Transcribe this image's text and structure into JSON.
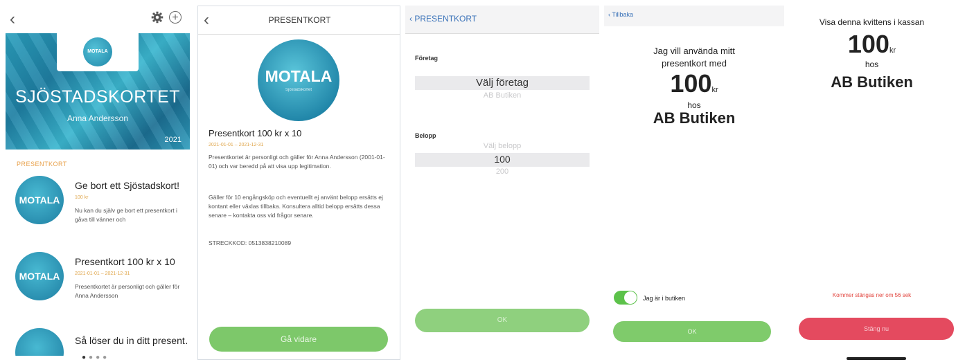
{
  "screen1": {
    "back_icon": "chevron-left-icon",
    "settings_icon": "gear-icon",
    "add_icon": "plus-circle-icon",
    "card": {
      "logo_text": "MOTALA",
      "title": "SJÖSTADSKORTET",
      "holder": "Anna Andersson",
      "year": "2021"
    },
    "section_label": "PRESENTKORT",
    "offers": [
      {
        "logo": "MOTALA",
        "title": "Ge bort ett Sjöstadskort!",
        "sub": "100 kr",
        "text": "Nu kan du själv ge bort ett presentkort i gåva till vänner och"
      },
      {
        "logo": "MOTALA",
        "title": "Presentkort 100 kr x 10",
        "sub": "2021-01-01 – 2021-12-31",
        "text": "Presentkortet är personligt och gäller för Anna Andersson"
      },
      {
        "logo": "",
        "title": "Så löser du in ditt present…",
        "sub": "",
        "text": ""
      }
    ]
  },
  "screen2": {
    "back_icon": "chevron-left-icon",
    "title": "PRESENTKORT",
    "logo_text": "MOTALA",
    "logo_sub": "Sjöstadskortet",
    "heading": "Presentkort 100 kr x 10",
    "sub": "2021-01-01 – 2021-12-31",
    "paragraph1": "Presentkortet är personligt och gäller för Anna Andersson (2001-01-01) och var beredd på att visa upp legitimation.",
    "paragraph2": "Gäller för 10 engångsköp och eventuellt ej använt belopp ersätts ej kontant eller växlas tillbaka. Konsultera alltid belopp ersätts dessa senare – kontakta oss vid frågor senare.",
    "barcode": "STRECKKOD: 0513838210089",
    "button": "Gå vidare"
  },
  "screen3": {
    "back": "PRESENTKORT",
    "company_label": "Företag",
    "company_selected": "Välj företag",
    "company_next": "AB Butiken",
    "amount_label": "Belopp",
    "amount_prev": "Välj belopp",
    "amount_selected": "100",
    "amount_next": "200",
    "button": "OK"
  },
  "screen4": {
    "back": "Tillbaka",
    "line1": "Jag vill använda mitt",
    "line2": "presentkort med",
    "amount": "100",
    "unit": "kr",
    "hos": "hos",
    "shop": "AB Butiken",
    "toggle_label": "Jag är i butiken",
    "toggle_on": true,
    "button": "OK"
  },
  "screen5": {
    "line1": "Visa denna kvittens i kassan",
    "amount": "100",
    "unit": "kr",
    "hos": "hos",
    "shop": "AB Butiken",
    "warning": "Kommer stängas ner om 56 sek",
    "button": "Stäng nu"
  }
}
